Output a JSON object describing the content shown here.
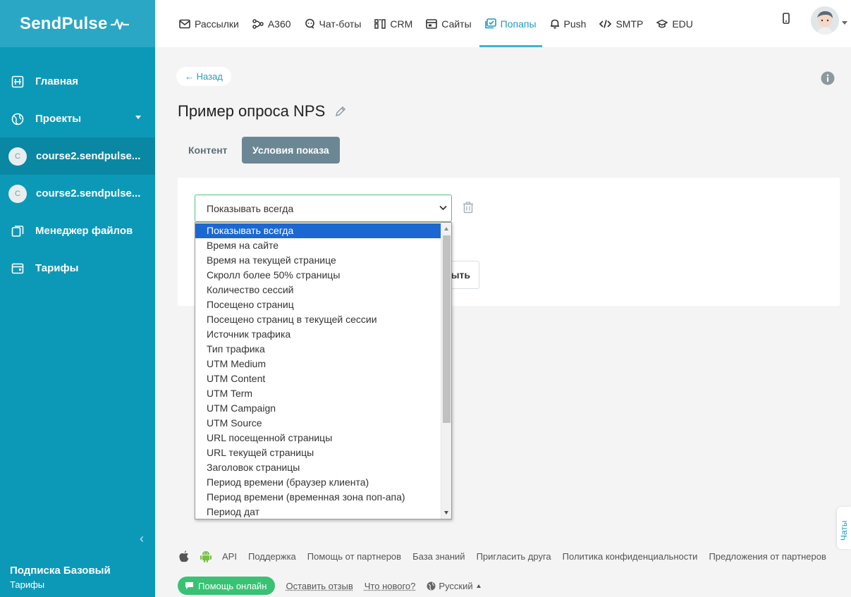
{
  "sidebar": {
    "logo": "SendPulse",
    "items": [
      {
        "label": "Главная",
        "icon": "dashboard-icon"
      },
      {
        "label": "Проекты",
        "icon": "globe-icon"
      },
      {
        "label": "course2.sendpulse...",
        "avatar": "C"
      },
      {
        "label": "course2.sendpulse...",
        "avatar": "C"
      },
      {
        "label": "Менеджер файлов",
        "icon": "files-icon"
      },
      {
        "label": "Тарифы",
        "icon": "wallet-icon"
      }
    ],
    "subscription_title": "Подписка Базовый",
    "subscription_link": "Тарифы"
  },
  "topnav": {
    "items": [
      {
        "label": "Рассылки",
        "icon": "mail-icon"
      },
      {
        "label": "A360",
        "icon": "flow-icon"
      },
      {
        "label": "Чат-боты",
        "icon": "chat-icon"
      },
      {
        "label": "CRM",
        "icon": "crm-icon"
      },
      {
        "label": "Сайты",
        "icon": "site-icon"
      },
      {
        "label": "Попапы",
        "icon": "popup-icon"
      },
      {
        "label": "Push",
        "icon": "bell-icon"
      },
      {
        "label": "SMTP",
        "icon": "code-icon"
      },
      {
        "label": "EDU",
        "icon": "graduation-icon"
      }
    ],
    "active_index": 5
  },
  "main": {
    "back_label": "← Назад",
    "title": "Пример опроса NPS",
    "tabs": [
      {
        "label": "Контент"
      },
      {
        "label": "Условия показа"
      }
    ],
    "select_value": "Показывать всегда",
    "partial_button_label": "рыть",
    "dropdown_options": [
      "Показывать всегда",
      "Время на сайте",
      "Время на текущей странице",
      "Скролл более 50% страницы",
      "Количество сессий",
      "Посещено страниц",
      "Посещено страниц в текущей сессии",
      "Источник трафика",
      "Тип трафика",
      "UTM Medium",
      "UTM Content",
      "UTM Term",
      "UTM Campaign",
      "UTM Source",
      "URL посещенной страницы",
      "URL текущей страницы",
      "Заголовок страницы",
      "Период времени (браузер клиента)",
      "Период времени (временная зона поп-апа)",
      "Период дат"
    ]
  },
  "footer": {
    "links": [
      "API",
      "Поддержка",
      "Помощь от партнеров",
      "База знаний",
      "Пригласить друга",
      "Политика конфиденциальности",
      "Предложения от партнеров"
    ],
    "help_button": "Помощь онлайн",
    "feedback": "Оставить отзыв",
    "whats_new": "Что нового?",
    "language": "Русский"
  },
  "chats_tab": "Чаты",
  "colors": {
    "sidebar": "#0c99b7",
    "logo_bg": "#2aa7c5",
    "accent": "#1b9bbf",
    "active_tab": "#6c8794",
    "green": "#39c274",
    "selected_option": "#1c68d3"
  }
}
